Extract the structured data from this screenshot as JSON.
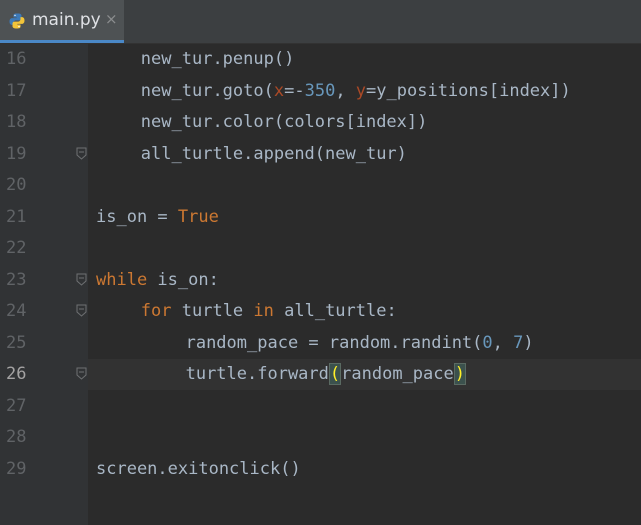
{
  "tab": {
    "filename": "main.py",
    "close": "×"
  },
  "lines": [
    {
      "n": "16",
      "indent": 4,
      "tokens": [
        {
          "t": "new_tur.penup()",
          "c": "plain"
        }
      ]
    },
    {
      "n": "17",
      "indent": 4,
      "tokens": [
        {
          "t": "new_tur.goto(",
          "c": "plain"
        },
        {
          "t": "x",
          "c": "param"
        },
        {
          "t": "=-",
          "c": "plain"
        },
        {
          "t": "350",
          "c": "num-lit"
        },
        {
          "t": ", ",
          "c": "plain"
        },
        {
          "t": "y",
          "c": "param"
        },
        {
          "t": "=y_positions[index])",
          "c": "plain"
        }
      ]
    },
    {
      "n": "18",
      "indent": 4,
      "tokens": [
        {
          "t": "new_tur.color(colors[index])",
          "c": "plain"
        }
      ]
    },
    {
      "n": "19",
      "indent": 4,
      "fold": true,
      "tokens": [
        {
          "t": "all_turtle.append(new_tur)",
          "c": "plain"
        }
      ]
    },
    {
      "n": "20",
      "indent": 0,
      "tokens": []
    },
    {
      "n": "21",
      "indent": 0,
      "tokens": [
        {
          "t": "is_on = ",
          "c": "plain"
        },
        {
          "t": "True",
          "c": "bool"
        }
      ]
    },
    {
      "n": "22",
      "indent": 0,
      "tokens": []
    },
    {
      "n": "23",
      "indent": 0,
      "fold": true,
      "tokens": [
        {
          "t": "while",
          "c": "kw"
        },
        {
          "t": " is_on:",
          "c": "plain"
        }
      ]
    },
    {
      "n": "24",
      "indent": 4,
      "fold": true,
      "tokens": [
        {
          "t": "for",
          "c": "kw"
        },
        {
          "t": " turtle ",
          "c": "plain"
        },
        {
          "t": "in",
          "c": "kw"
        },
        {
          "t": " all_turtle:",
          "c": "plain"
        }
      ]
    },
    {
      "n": "25",
      "indent": 8,
      "tokens": [
        {
          "t": "random_pace = random.randint(",
          "c": "plain"
        },
        {
          "t": "0",
          "c": "num-lit"
        },
        {
          "t": ", ",
          "c": "plain"
        },
        {
          "t": "7",
          "c": "num-lit"
        },
        {
          "t": ")",
          "c": "plain"
        }
      ]
    },
    {
      "n": "26",
      "indent": 8,
      "fold": true,
      "current": true,
      "tokens": [
        {
          "t": "turtle.forward",
          "c": "plain"
        },
        {
          "t": "(",
          "c": "brace"
        },
        {
          "t": "random_pace",
          "c": "plain"
        },
        {
          "t": ")",
          "c": "brace"
        }
      ]
    },
    {
      "n": "27",
      "indent": 0,
      "tokens": []
    },
    {
      "n": "28",
      "indent": 0,
      "tokens": []
    },
    {
      "n": "29",
      "indent": 0,
      "tokens": [
        {
          "t": "screen.exitonclick()",
          "c": "plain"
        }
      ]
    }
  ]
}
